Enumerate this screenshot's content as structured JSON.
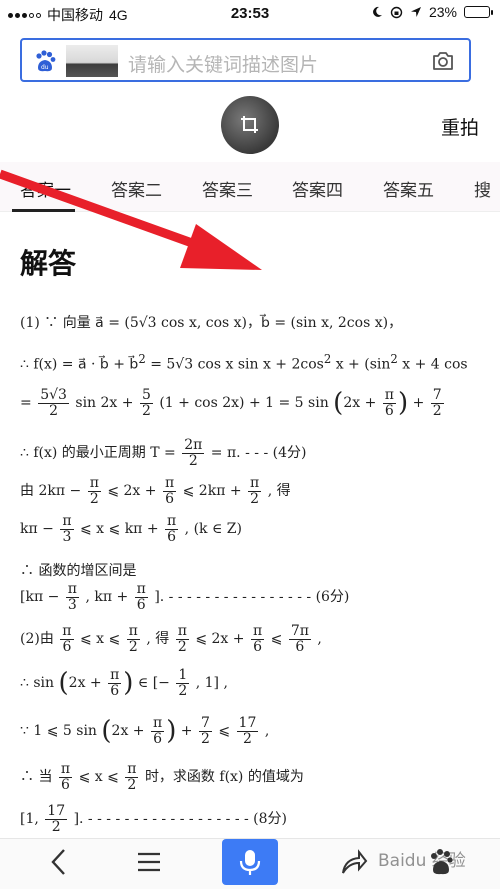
{
  "status_bar": {
    "carrier": "中国移动",
    "network": "4G",
    "time": "23:53",
    "battery": "23%",
    "battery_level": 0.23
  },
  "search": {
    "placeholder": "请输入关键词描述图片"
  },
  "retake_label": "重拍",
  "tabs": [
    {
      "label": "答案一",
      "active": true
    },
    {
      "label": "答案二"
    },
    {
      "label": "答案三"
    },
    {
      "label": "答案四"
    },
    {
      "label": "答案五"
    },
    {
      "label": "搜"
    }
  ],
  "answer_title": "解答",
  "solution": {
    "l1": "(1) ∵ 向量 a⃗ = (5√3 cos x, cos x)，b⃗ = (sin x, 2cos x)，",
    "l2a": "∴ f(x) = a⃗ · b⃗ + b⃗",
    "l2sup": "2",
    "l2b": " = 5√3 cos x sin x + 2cos",
    "l2sup2": "2",
    "l2c": " x + (sin",
    "l2sup3": "2",
    "l2d": " x + 4 cos",
    "l3_eq": "=",
    "l3_f1n": "5√3",
    "l3_f1d": "2",
    "l3_mid": "sin 2x +",
    "l3_f2n": "5",
    "l3_f2d": "2",
    "l3_mid2": "(1 + cos 2x) + 1 = 5 sin",
    "l3_lp": "(",
    "l3_in": "2x +",
    "l3_f3n": "π",
    "l3_f3d": "6",
    "l3_rp": ")",
    "l3_plus": "+",
    "l3_f4n": "7",
    "l3_f4d": "2",
    "l4a": "∴ f(x)  的最小正周期 T =",
    "l4_fn": "2π",
    "l4_fd": "2",
    "l4b": "= π. - - - (4分)",
    "l5a": "由 2kπ −",
    "l5_f1n": "π",
    "l5_f1d": "2",
    "l5b": "⩽ 2x +",
    "l5_f2n": "π",
    "l5_f2d": "6",
    "l5c": "⩽ 2kπ +",
    "l5_f3n": "π",
    "l5_f3d": "2",
    "l5d": ", 得",
    "l6a": "kπ −",
    "l6_f1n": "π",
    "l6_f1d": "3",
    "l6b": "⩽ x ⩽ kπ +",
    "l6_f2n": "π",
    "l6_f2d": "6",
    "l6c": ", (k ∈ Z)",
    "l7": "∴ 函数的增区间是",
    "l8a": "[kπ −",
    "l8_f1n": "π",
    "l8_f1d": "3",
    "l8b": ", kπ +",
    "l8_f2n": "π",
    "l8_f2d": "6",
    "l8c": "]. - - - - - - - - - - - - - - - - (6分)",
    "l9a": "(2)由",
    "l9_f1n": "π",
    "l9_f1d": "6",
    "l9b": "⩽ x ⩽",
    "l9_f2n": "π",
    "l9_f2d": "2",
    "l9c": ", 得",
    "l9_f3n": "π",
    "l9_f3d": "2",
    "l9d": "⩽ 2x +",
    "l9_f4n": "π",
    "l9_f4d": "6",
    "l9e": "⩽",
    "l9_f5n": "7π",
    "l9_f5d": "6",
    "l9f": ",",
    "l10a": "∴ sin",
    "l10_lp": "(",
    "l10b": "2x +",
    "l10_fn": "π",
    "l10_fd": "6",
    "l10_rp": ")",
    "l10c": "∈ [−",
    "l10_f2n": "1",
    "l10_f2d": "2",
    "l10d": ",   1] ,",
    "l11a": "∵ 1 ⩽ 5 sin",
    "l11_lp": "(",
    "l11b": "2x +",
    "l11_fn": "π",
    "l11_fd": "6",
    "l11_rp": ")",
    "l11c": "+",
    "l11_f2n": "7",
    "l11_f2d": "2",
    "l11d": "⩽",
    "l11_f3n": "17",
    "l11_f3d": "2",
    "l11e": ",",
    "l12a": "∴ 当",
    "l12_f1n": "π",
    "l12_f1d": "6",
    "l12b": "⩽ x ⩽",
    "l12_f2n": "π",
    "l12_f2d": "2",
    "l12c": "时，求函数 f(x)  的值域为",
    "l13a": "[1,",
    "l13_fn": "17",
    "l13_fd": "2",
    "l13b": "]. - - - - - - - - - - - - - - - - - - (8分)"
  },
  "watermark": "Baidu 经验"
}
